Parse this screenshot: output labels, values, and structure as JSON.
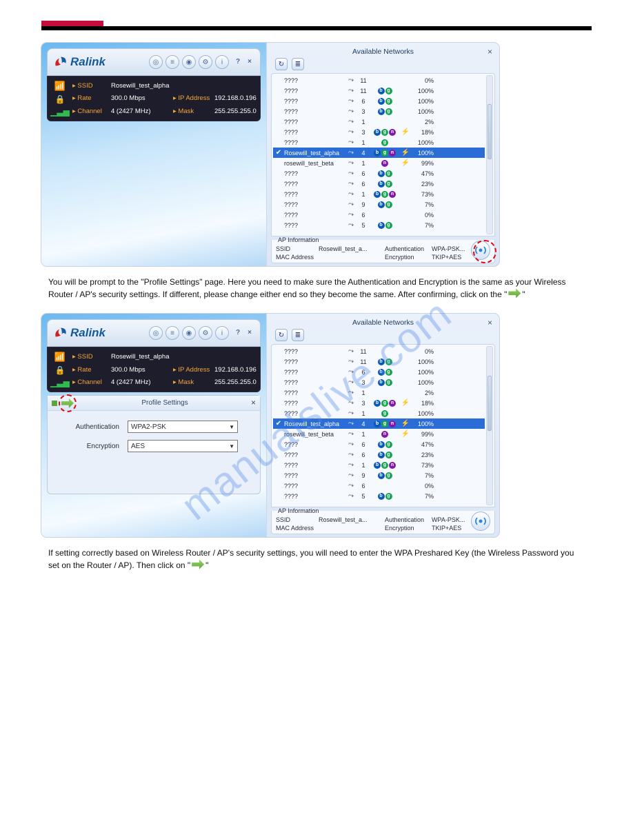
{
  "ralink_brand": "Ralink",
  "status": {
    "ssid_label": "SSID",
    "ssid_value": "Rosewill_test_alpha",
    "rate_label": "Rate",
    "rate_value": "300.0 Mbps",
    "channel_label": "Channel",
    "channel_value": "4 (2427 MHz)",
    "ip_label": "IP Address",
    "ip_value": "192.168.0.196",
    "mask_label": "Mask",
    "mask_value": "255.255.255.0"
  },
  "available_networks_title": "Available Networks",
  "networks": [
    {
      "name": "????",
      "ch": "11",
      "modes": "",
      "sec": "",
      "pct": "0%"
    },
    {
      "name": "????",
      "ch": "11",
      "modes": "bg",
      "sec": "",
      "pct": "100%"
    },
    {
      "name": "????",
      "ch": "6",
      "modes": "bg",
      "sec": "",
      "pct": "100%"
    },
    {
      "name": "????",
      "ch": "3",
      "modes": "bg",
      "sec": "",
      "pct": "100%"
    },
    {
      "name": "????",
      "ch": "1",
      "modes": "",
      "sec": "",
      "pct": "2%"
    },
    {
      "name": "????",
      "ch": "3",
      "modes": "bgn",
      "sec": "⚡",
      "pct": "18%"
    },
    {
      "name": "????",
      "ch": "1",
      "modes": "g",
      "sec": "",
      "pct": "100%"
    },
    {
      "name": "Rosewill_test_alpha",
      "ch": "4",
      "modes": "bgn",
      "sec": "⚡",
      "pct": "100%",
      "sel": true,
      "check": true
    },
    {
      "name": "rosewill_test_beta",
      "ch": "1",
      "modes": "n",
      "sec": "⚡",
      "pct": "99%"
    },
    {
      "name": "????",
      "ch": "6",
      "modes": "bg",
      "sec": "",
      "pct": "47%"
    },
    {
      "name": "????",
      "ch": "6",
      "modes": "bg",
      "sec": "",
      "pct": "23%"
    },
    {
      "name": "????",
      "ch": "1",
      "modes": "bgn",
      "sec": "",
      "pct": "73%"
    },
    {
      "name": "????",
      "ch": "9",
      "modes": "bg",
      "sec": "",
      "pct": "7%"
    },
    {
      "name": "????",
      "ch": "6",
      "modes": "",
      "sec": "",
      "pct": "0%"
    },
    {
      "name": "????",
      "ch": "5",
      "modes": "bg",
      "sec": "",
      "pct": "7%"
    }
  ],
  "ap_info": {
    "legend": "AP Information",
    "ssid_label": "SSID",
    "ssid_value": "Rosewill_test_a...",
    "auth_label": "Authentication",
    "auth_value": "WPA-PSK...",
    "mac_label": "MAC Address",
    "mac_value": "",
    "enc_label": "Encryption",
    "enc_value": "TKIP+AES"
  },
  "profile_settings_title": "Profile Settings",
  "profile": {
    "auth_label": "Authentication",
    "auth_value": "WPA2-PSK",
    "enc_label": "Encryption",
    "enc_value": "AES"
  },
  "text1": "You will be prompt to the \"Profile Settings\" page. Here you need to make sure the Authentication and Encryption is the same as your Wireless Router / AP's security settings. If different, please change either end so they become the same. After confirming, click on the \"",
  "text1b": "\"",
  "text2a": "If setting correctly based on Wireless Router / AP's security settings, you will need to enter the WPA Preshared Key (the Wireless Password you set on the Router / AP). Then click on \"",
  "text2b": "\"",
  "watermark": "manualslive.com"
}
